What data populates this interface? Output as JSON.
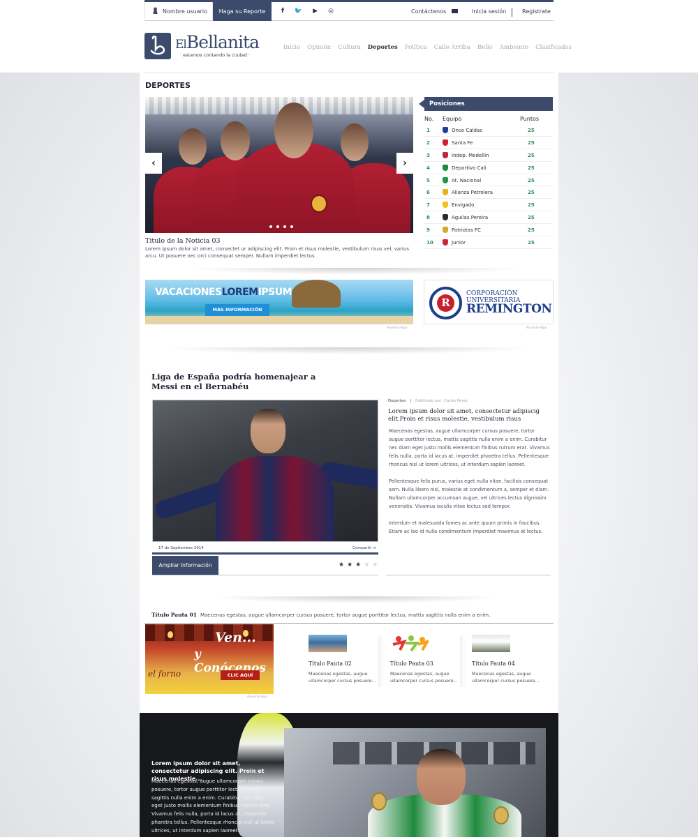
{
  "topbar": {
    "user_label": "Nombre usuario",
    "report_label": "Haga su Reporte",
    "social": [
      "f",
      "🐦",
      "▶",
      "◎"
    ],
    "contact_label": "Contáctenos",
    "login_label": "Inicia sesión",
    "register_label": "Registrate"
  },
  "brand": {
    "name_prefix": "El",
    "name": "Bellanita",
    "tagline": "· estamos contando la ciudad ·"
  },
  "nav": {
    "items": [
      "Inicio",
      "Opinión",
      "Cultura",
      "Deportes",
      "Política",
      "Calle Arriba",
      "Bello",
      "Ambiente",
      "Clasificados"
    ],
    "active": "Deportes"
  },
  "section": {
    "title": "DEPORTES"
  },
  "slider": {
    "title": "Titulo de la Noticia 03",
    "text": "Lorem ipsum dolor sit amet, consectet ur adipiscing elit. Proin et risus molestie, vestibulum risus vel, varius arcu. Ut posuere nec orci consequat semper. Nullam imperdiet lectus",
    "prev_icon": "‹",
    "next_icon": "›",
    "slides": 4
  },
  "standings": {
    "title": "Posiciones",
    "col_no": "No.",
    "col_team": "Equipo",
    "col_points": "Puntos",
    "rows": [
      {
        "no": "1",
        "team": "Once Caldas",
        "points": "25",
        "color": "#1f3e8f"
      },
      {
        "no": "2",
        "team": "Santa Fe",
        "points": "25",
        "color": "#d32030"
      },
      {
        "no": "3",
        "team": "Indep. Medellin",
        "points": "25",
        "color": "#c2223a"
      },
      {
        "no": "4",
        "team": "Deportivo Cali",
        "points": "25",
        "color": "#1b8a3c"
      },
      {
        "no": "5",
        "team": "At. Nacional",
        "points": "25",
        "color": "#1a9a48"
      },
      {
        "no": "6",
        "team": "Alianza Petrolera",
        "points": "25",
        "color": "#e0b51c"
      },
      {
        "no": "7",
        "team": "Envigado",
        "points": "25",
        "color": "#f0c21a"
      },
      {
        "no": "8",
        "team": "Aguilas Pereira",
        "points": "25",
        "color": "#2a2b30"
      },
      {
        "no": "9",
        "team": "Patriotas FC",
        "points": "25",
        "color": "#d6a82a"
      },
      {
        "no": "10",
        "team": "Junior",
        "points": "25",
        "color": "#c72a3a"
      }
    ]
  },
  "ads": {
    "vacation_word1": "VACACIONES",
    "vacation_word2": "LOREM",
    "vacation_word3": "IPSUM",
    "vacation_button": "MÁS INFORMACIÓN",
    "note": "Anuncie Aquí",
    "remington_seal": "R",
    "remington_line1": "CORPORACIÓN UNIVERSITARIA",
    "remington_line2": "REMINGTON",
    "food_line1": "Ven...",
    "food_line2": "y Conócenos",
    "food_button": "CLIC AQUÍ",
    "food_brand": "el forno"
  },
  "article": {
    "title": "Liga de España podría homenajear a Messi en el Bernabéu",
    "date": "17 de Septiembre 2014",
    "share_label": "Compartir",
    "more_button": "Ampliar Información",
    "rating": 3,
    "rating_max": 5,
    "category": "Deportes",
    "author": "Publicado por: Carlos Pérez",
    "lead": "Lorem ipsum dolor sit amet, consectetur adipiscig elit.Proin et risus molestie, vestibulum risus",
    "body1": "Maecenas egestas, augue ullamcorper cursus posuere, tortor augue porttitor lectus, mattis sagittis nulla enim a enim. Curabitur nec diam eget justo mollis elementum finibus rutrum erat. Vivamus felis nulla, porta id iacus at, imperdiet pharetra tellus. Pellentesque rhoncus nisl ut lorem ultrices, ut interdum sapien laoreet.",
    "body2": "Pellentesque felis purus, varius eget nulla vitae, facilisis consequat sem. Nulla libero nisl, molestie at condimentum a, semper et diam. Nullam ullamcorper accumsan augue, vel ultrices lectus dignissim venenatis. Vivamus iaculis vitae lectus sed tempor.",
    "body3": "Interdum et malesuada fames ac ante ipsum primis in faucibus. Etiam ac leo id nulla condimentum imperdiet maximus at lectus."
  },
  "pautas": {
    "main_title": "Título Pauta 01",
    "main_text": "Maecenas egestas, augue ullamcorper cursus posuere, tortor augue porttitor lectus, mattis sagittis nulla enim a enim.",
    "cards": [
      {
        "title": "Título Pauta 02",
        "text": "Maecenas egestas, augue ullamcorper cursus posuere..."
      },
      {
        "title": "Título Pauta 03",
        "text": "Maecenas egestas, augue ullamcorper cursus posuere..."
      },
      {
        "title": "Título Pauta 04",
        "text": "Maecenas egestas, augue ullamcorper cursus posuere..."
      }
    ]
  },
  "bottom_feature": {
    "title": "Lorem ipsum dolor sit amet, consectetur adipiscing elit. Proin et risus molestie...",
    "text": "Maecenas egestas, augue ullamcorper cursus posuere, tortor augue porttitor lectus, mattis sagittis nulla enim a enim. Curabitur nec diam eget justo mollis elementum finibus rutrum erat. Vivamus felis nulla, porta id lacus at, imperdiet pharetra tellus. Pellentesque rhoncus nisl ut lorem ultrices, ut interdum sapien laoreet."
  },
  "colors": {
    "navy": "#3c4a6b",
    "green_points": "#2e8b57",
    "vacation_blue": "#1f8fd6",
    "remington_blue": "#1d3d8a"
  }
}
